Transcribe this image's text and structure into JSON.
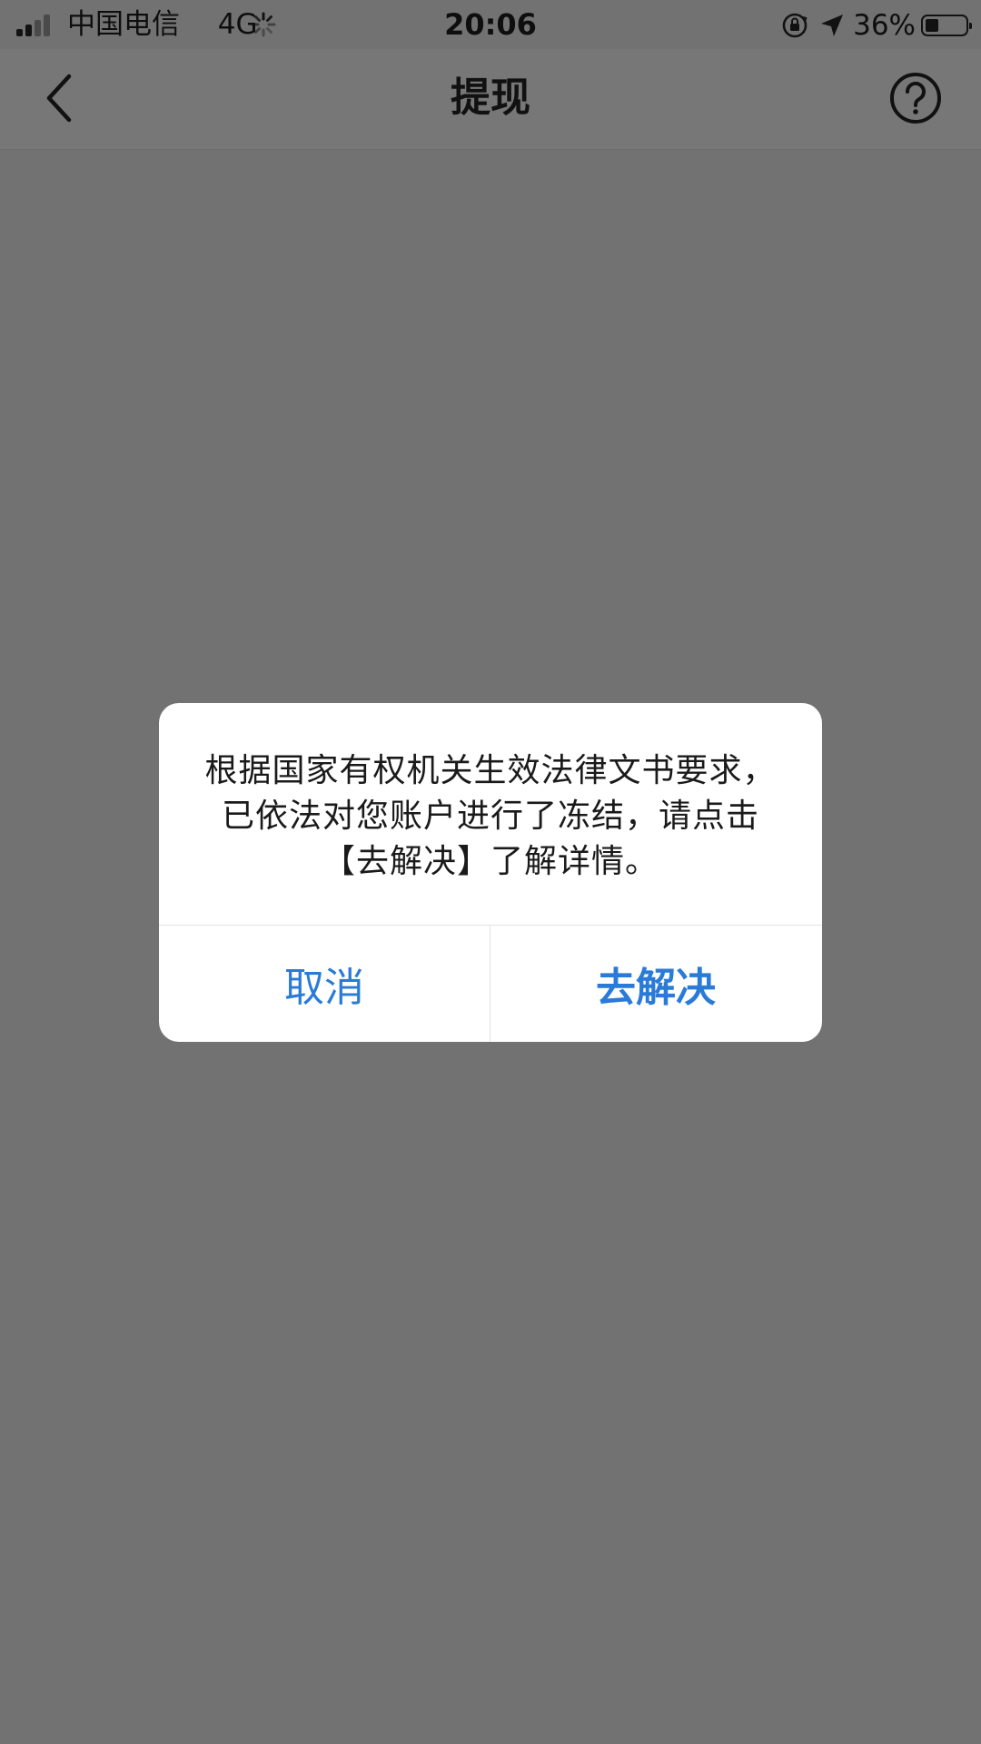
{
  "status_bar": {
    "carrier": "中国电信",
    "network": "4G",
    "time": "20:06",
    "battery_percent": "36%"
  },
  "nav": {
    "title": "提现",
    "back_icon": "chevron-left-icon",
    "help_icon": "question-circle-icon"
  },
  "dialog": {
    "message": "根据国家有权机关生效法律文书要求，已依法对您账户进行了冻结，请点击【去解决】了解详情。",
    "cancel_label": "取消",
    "confirm_label": "去解决"
  },
  "colors": {
    "overlay": "#727272",
    "accent": "#2a7bd8",
    "dialog_bg": "#ffffff"
  }
}
